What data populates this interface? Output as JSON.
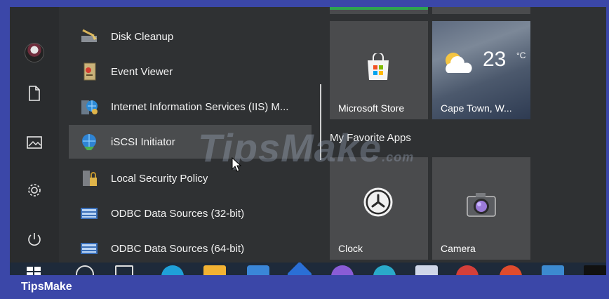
{
  "rail": {
    "items": [
      {
        "name": "user-avatar"
      },
      {
        "name": "documents-icon"
      },
      {
        "name": "pictures-icon"
      },
      {
        "name": "settings-icon"
      },
      {
        "name": "power-icon"
      }
    ]
  },
  "app_list": {
    "items": [
      {
        "label": "Disk Cleanup",
        "icon": "disk-cleanup-icon"
      },
      {
        "label": "Event Viewer",
        "icon": "event-viewer-icon"
      },
      {
        "label": "Internet Information Services (IIS) M...",
        "icon": "iis-manager-icon"
      },
      {
        "label": "iSCSI Initiator",
        "icon": "iscsi-initiator-icon",
        "hover": true
      },
      {
        "label": "Local Security Policy",
        "icon": "local-security-policy-icon"
      },
      {
        "label": "ODBC Data Sources (32-bit)",
        "icon": "odbc-32-icon"
      },
      {
        "label": "ODBC Data Sources (64-bit)",
        "icon": "odbc-64-icon"
      }
    ]
  },
  "tiles": {
    "microsoft_store": {
      "label": "Microsoft Store",
      "icon": "store-bag-icon"
    },
    "weather": {
      "temp": "23",
      "unit": "°C",
      "location": "Cape Town, W...",
      "icon": "partly-cloudy-icon"
    },
    "group_label": "My Favorite Apps",
    "clock": {
      "label": "Clock",
      "icon": "alarm-clock-icon"
    },
    "camera": {
      "label": "Camera",
      "icon": "camera-icon"
    }
  },
  "watermark": {
    "text": "TipsMake",
    "suffix": ".com"
  },
  "caption": {
    "text": "TipsMake"
  },
  "colors": {
    "accent_bar": "#2ea44f",
    "frame": "#3b47a8",
    "menu_bg": "#2f3133"
  }
}
